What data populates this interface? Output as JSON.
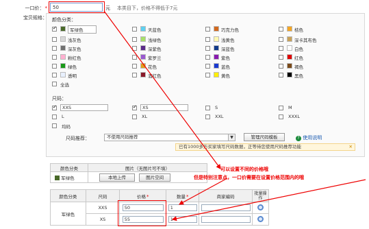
{
  "price": {
    "label": "一口价：",
    "required_mark": "*",
    "value": "50",
    "unit": "元",
    "hint": "本类目下，价格不得低于7元"
  },
  "spec": {
    "label": "宝贝规格："
  },
  "color_section": {
    "title": "颜色分类：",
    "items": [
      {
        "name": "军绿色",
        "checked": true,
        "color": "#4a6a2a"
      },
      {
        "name": "天蓝色",
        "checked": false,
        "color": "#5fd0f0"
      },
      {
        "name": "巧克力色",
        "checked": false,
        "color": "#d2691e"
      },
      {
        "name": "桔色",
        "checked": false,
        "color": "#f5a623"
      },
      {
        "name": "浅灰色",
        "checked": false,
        "color": "#d8d8d8"
      },
      {
        "name": "浅绿色",
        "checked": false,
        "color": "#a8e06a"
      },
      {
        "name": "浅黄色",
        "checked": false,
        "color": "#fff8b0"
      },
      {
        "name": "深卡其布色",
        "checked": false,
        "color": "#c8a25a"
      },
      {
        "name": "深灰色",
        "checked": false,
        "color": "#707070"
      },
      {
        "name": "深紫色",
        "checked": false,
        "color": "#5a2a8a"
      },
      {
        "name": "深蓝色",
        "checked": false,
        "color": "#123a8a"
      },
      {
        "name": "白色",
        "checked": false,
        "color": "#ffffff"
      },
      {
        "name": "粉红色",
        "checked": false,
        "color": "#ffb0d0"
      },
      {
        "name": "紫罗兰",
        "checked": false,
        "color": "#9a5ad0"
      },
      {
        "name": "紫色",
        "checked": false,
        "color": "#8a1ab0"
      },
      {
        "name": "红色",
        "checked": false,
        "color": "#e00000"
      },
      {
        "name": "绿色",
        "checked": false,
        "color": "#1a9a1a"
      },
      {
        "name": "花色",
        "checked": false,
        "color": "#e0a020"
      },
      {
        "name": "蓝色",
        "checked": false,
        "color": "#1a3ad0"
      },
      {
        "name": "褐色",
        "checked": false,
        "color": "#7a4a1a"
      },
      {
        "name": "透明",
        "checked": false,
        "color": "#e8f0ff"
      },
      {
        "name": "酒红色",
        "checked": false,
        "color": "#8a1a2a"
      },
      {
        "name": "黄色",
        "checked": false,
        "color": "#ffee00"
      },
      {
        "name": "黑色",
        "checked": false,
        "color": "#000000"
      },
      {
        "name": "全选",
        "checked": false,
        "color": ""
      }
    ]
  },
  "size_section": {
    "title": "尺码：",
    "items": [
      {
        "name": "XXS",
        "checked": true,
        "boxed": true
      },
      {
        "name": "XS",
        "checked": true,
        "boxed": true
      },
      {
        "name": "S",
        "checked": false,
        "boxed": false
      },
      {
        "name": "M",
        "checked": false,
        "boxed": false
      },
      {
        "name": "L",
        "checked": false,
        "boxed": false
      },
      {
        "name": "XL",
        "checked": false,
        "boxed": false
      },
      {
        "name": "XXL",
        "checked": false,
        "boxed": false
      },
      {
        "name": "XXXL",
        "checked": false,
        "boxed": false
      },
      {
        "name": "均码",
        "checked": false,
        "boxed": false
      }
    ],
    "recommend_label": "尺码推荐：",
    "recommend_value": "不使用尺码推荐",
    "manage_button": "管理尺码模板",
    "help_link": "使用说明",
    "tip": "已有1000多万买家填写尺码数据，正等待您使用尺码推荐功能"
  },
  "image_table": {
    "headers": [
      "颜色分类",
      "图片（无图片可不填）"
    ],
    "row": {
      "color": "军绿色",
      "upload": "本地上传",
      "space": "图片空间"
    }
  },
  "sku_table": {
    "headers": [
      "颜色分类",
      "尺码",
      "价格",
      "数量",
      "商家编码",
      "批量操作"
    ],
    "required_mark": "*",
    "rows": [
      {
        "color": "军绿色",
        "size": "XXS",
        "price": "50",
        "qty": "1",
        "code": ""
      },
      {
        "color": "",
        "size": "XS",
        "price": "55",
        "qty": "1",
        "code": ""
      }
    ]
  },
  "annotation": {
    "line1": "可以设置不同的价格哦",
    "line2": "但是特别注意点，一口价需要在设置价格范围内的哦"
  }
}
